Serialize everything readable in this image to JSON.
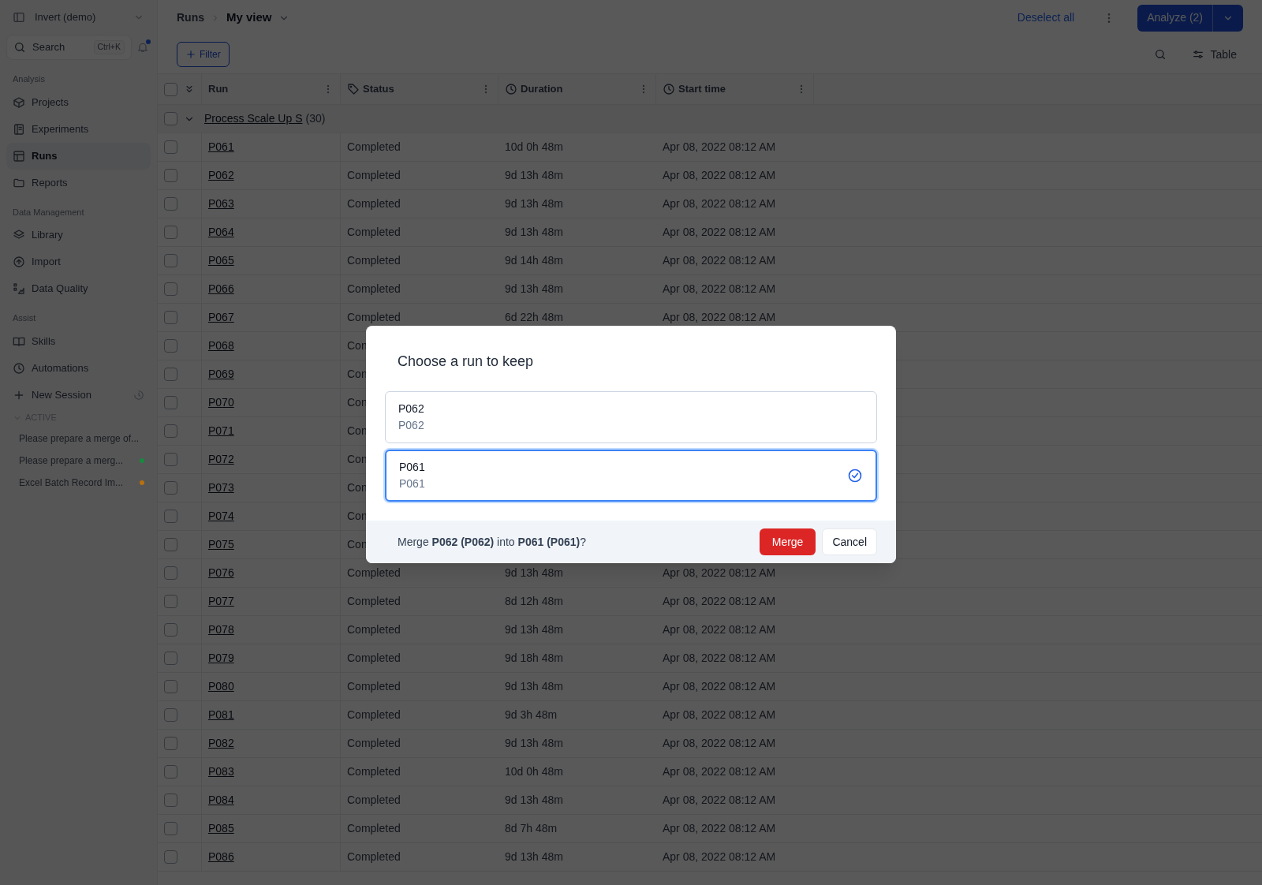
{
  "sidebar": {
    "workspace": "Invert (demo)",
    "search": {
      "placeholder": "Search",
      "shortcut": "Ctrl+K"
    },
    "notifications_unread": true,
    "sections": [
      {
        "title": "Analysis",
        "items": [
          {
            "label": "Projects",
            "selected": false
          },
          {
            "label": "Experiments",
            "selected": false
          },
          {
            "label": "Runs",
            "selected": true
          },
          {
            "label": "Reports",
            "selected": false
          }
        ]
      },
      {
        "title": "Data Management",
        "items": [
          {
            "label": "Library",
            "selected": false
          },
          {
            "label": "Import",
            "selected": false
          },
          {
            "label": "Data Quality",
            "selected": false
          }
        ]
      },
      {
        "title": "Assist",
        "items": [
          {
            "label": "Skills",
            "selected": false
          },
          {
            "label": "Automations",
            "selected": false
          }
        ]
      }
    ],
    "new_session": "New Session",
    "sessions_header": "ACTIVE",
    "sessions": [
      {
        "title": "Please prepare a merge of..."
      },
      {
        "title": "Please prepare a merg...",
        "color": "#178a3d"
      },
      {
        "title": "Excel Batch Record Im...",
        "color": "#b8700f"
      }
    ]
  },
  "header": {
    "breadcrumb": "Runs",
    "view": "My view",
    "deselect": "Deselect all",
    "analyze": "Analyze (2)"
  },
  "toolbar": {
    "filter": "Filter",
    "view_mode": "Table"
  },
  "table": {
    "all_checked": false,
    "columns": [
      {
        "label": "Run"
      },
      {
        "label": "Status"
      },
      {
        "label": "Duration"
      },
      {
        "label": "Start time"
      }
    ],
    "group": {
      "name": "Process Scale Up S",
      "count": "(30)",
      "expanded": true,
      "checked": false
    },
    "rows": [
      {
        "checked": false,
        "run": "P061",
        "status": "Completed",
        "duration": "10d 0h 48m",
        "start": "Apr 08, 2022 08:12 AM"
      },
      {
        "checked": false,
        "run": "P062",
        "status": "Completed",
        "duration": "9d 13h 48m",
        "start": "Apr 08, 2022 08:12 AM"
      },
      {
        "checked": false,
        "run": "P063",
        "status": "Completed",
        "duration": "9d 13h 48m",
        "start": "Apr 08, 2022 08:12 AM"
      },
      {
        "checked": false,
        "run": "P064",
        "status": "Completed",
        "duration": "9d 13h 48m",
        "start": "Apr 08, 2022 08:12 AM"
      },
      {
        "checked": false,
        "run": "P065",
        "status": "Completed",
        "duration": "9d 14h 48m",
        "start": "Apr 08, 2022 08:12 AM"
      },
      {
        "checked": false,
        "run": "P066",
        "status": "Completed",
        "duration": "9d 13h 48m",
        "start": "Apr 08, 2022 08:12 AM"
      },
      {
        "checked": false,
        "run": "P067",
        "status": "Completed",
        "duration": "6d 22h 48m",
        "start": "Apr 08, 2022 08:12 AM"
      },
      {
        "checked": false,
        "run": "P068",
        "status": "Con"
      },
      {
        "checked": false,
        "run": "P069",
        "status": "Con"
      },
      {
        "checked": false,
        "run": "P070",
        "status": "Con"
      },
      {
        "checked": false,
        "run": "P071",
        "status": "Con"
      },
      {
        "checked": false,
        "run": "P072",
        "status": "Con"
      },
      {
        "checked": false,
        "run": "P073",
        "status": "Con"
      },
      {
        "checked": false,
        "run": "P074",
        "status": "Con"
      },
      {
        "checked": false,
        "run": "P075",
        "status": "Con"
      },
      {
        "checked": false,
        "run": "P076",
        "status": "Completed",
        "duration": "9d 13h 48m",
        "start": "Apr 08, 2022 08:12 AM"
      },
      {
        "checked": false,
        "run": "P077",
        "status": "Completed",
        "duration": "8d 12h 48m",
        "start": "Apr 08, 2022 08:12 AM"
      },
      {
        "checked": false,
        "run": "P078",
        "status": "Completed",
        "duration": "9d 13h 48m",
        "start": "Apr 08, 2022 08:12 AM"
      },
      {
        "checked": false,
        "run": "P079",
        "status": "Completed",
        "duration": "9d 18h 48m",
        "start": "Apr 08, 2022 08:12 AM"
      },
      {
        "checked": false,
        "run": "P080",
        "status": "Completed",
        "duration": "9d 13h 48m",
        "start": "Apr 08, 2022 08:12 AM"
      },
      {
        "checked": false,
        "run": "P081",
        "status": "Completed",
        "duration": "9d 3h 48m",
        "start": "Apr 08, 2022 08:12 AM"
      },
      {
        "checked": false,
        "run": "P082",
        "status": "Completed",
        "duration": "9d 13h 48m",
        "start": "Apr 08, 2022 08:12 AM"
      },
      {
        "checked": false,
        "run": "P083",
        "status": "Completed",
        "duration": "10d 0h 48m",
        "start": "Apr 08, 2022 08:12 AM"
      },
      {
        "checked": false,
        "run": "P084",
        "status": "Completed",
        "duration": "9d 13h 48m",
        "start": "Apr 08, 2022 08:12 AM"
      },
      {
        "checked": false,
        "run": "P085",
        "status": "Completed",
        "duration": "8d 7h 48m",
        "start": "Apr 08, 2022 08:12 AM"
      },
      {
        "checked": false,
        "run": "P086",
        "status": "Completed",
        "duration": "9d 13h 48m",
        "start": "Apr 08, 2022 08:12 AM"
      }
    ]
  },
  "dialog": {
    "title": "Choose a run to keep",
    "options": [
      {
        "name": "P062",
        "subtitle": "P062",
        "selected": false
      },
      {
        "name": "P061",
        "subtitle": "P061",
        "selected": true
      }
    ],
    "message": "Merge **P062 (P062)** into **P061 (P061)**?",
    "confirm": "Merge",
    "cancel": "Cancel"
  }
}
